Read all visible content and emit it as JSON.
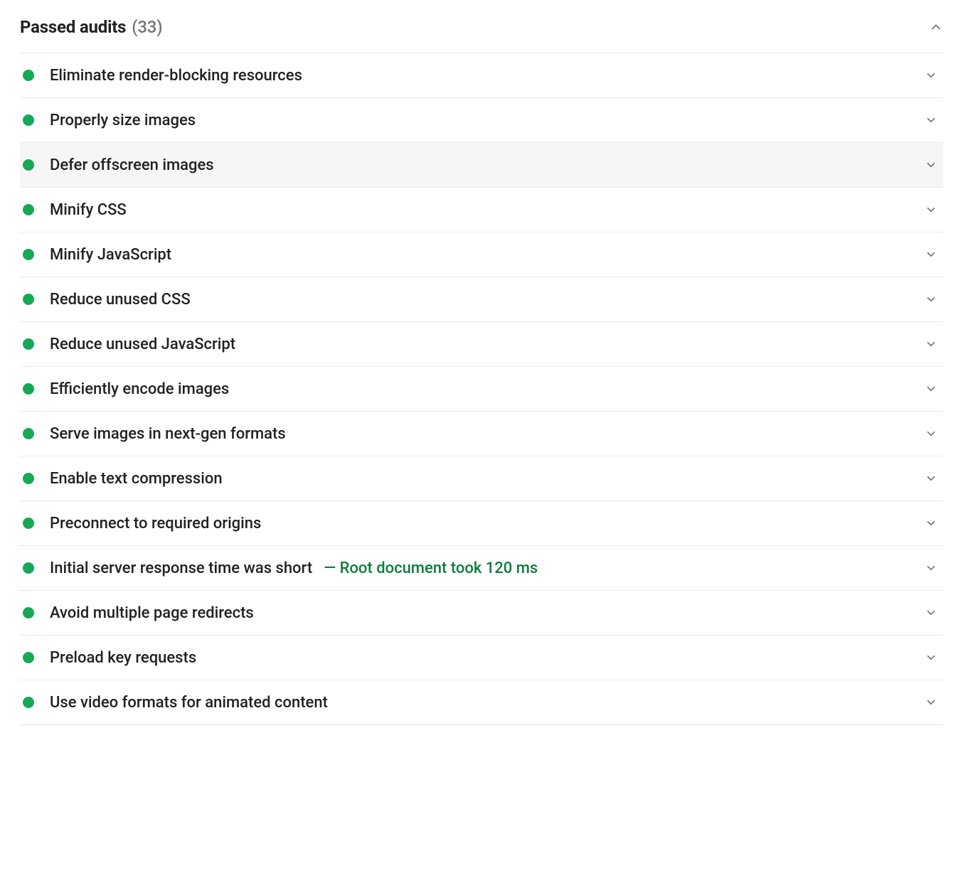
{
  "colors": {
    "pass": "#17a856",
    "detail": "#0e7c3a",
    "muted": "#757575"
  },
  "section": {
    "title": "Passed audits",
    "count_display": "(33)"
  },
  "audits": [
    {
      "label": "Eliminate render-blocking resources",
      "detail": ""
    },
    {
      "label": "Properly size images",
      "detail": ""
    },
    {
      "label": "Defer offscreen images",
      "detail": ""
    },
    {
      "label": "Minify CSS",
      "detail": ""
    },
    {
      "label": "Minify JavaScript",
      "detail": ""
    },
    {
      "label": "Reduce unused CSS",
      "detail": ""
    },
    {
      "label": "Reduce unused JavaScript",
      "detail": ""
    },
    {
      "label": "Efficiently encode images",
      "detail": ""
    },
    {
      "label": "Serve images in next-gen formats",
      "detail": ""
    },
    {
      "label": "Enable text compression",
      "detail": ""
    },
    {
      "label": "Preconnect to required origins",
      "detail": ""
    },
    {
      "label": "Initial server response time was short",
      "detail": "— Root document took 120 ms"
    },
    {
      "label": "Avoid multiple page redirects",
      "detail": ""
    },
    {
      "label": "Preload key requests",
      "detail": ""
    },
    {
      "label": "Use video formats for animated content",
      "detail": ""
    }
  ],
  "hover_index": 2
}
